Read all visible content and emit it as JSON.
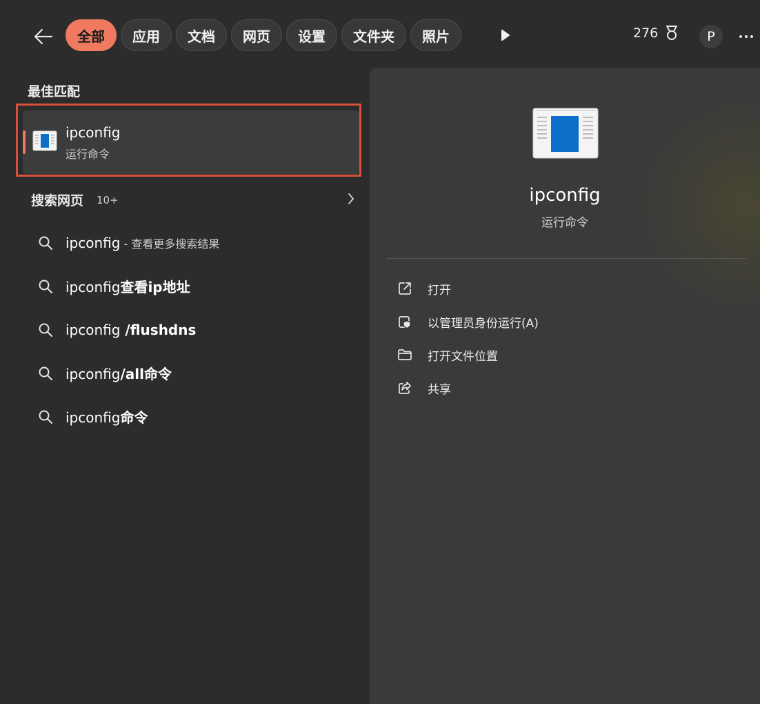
{
  "header": {
    "tabs": [
      {
        "label": "全部",
        "active": true
      },
      {
        "label": "应用",
        "active": false
      },
      {
        "label": "文档",
        "active": false
      },
      {
        "label": "网页",
        "active": false
      },
      {
        "label": "设置",
        "active": false
      },
      {
        "label": "文件夹",
        "active": false
      },
      {
        "label": "照片",
        "active": false
      }
    ],
    "points": "276",
    "avatar_initial": "P"
  },
  "best_match": {
    "title": "最佳匹配",
    "name": "ipconfig",
    "type": "运行命令"
  },
  "web_search": {
    "title": "搜索网页",
    "count": "10+",
    "suggestions": [
      {
        "prefix": "ipconfig",
        "rest": "",
        "sub": " - 查看更多搜索结果"
      },
      {
        "prefix": "ipconfig",
        "rest": "查看ip地址",
        "sub": ""
      },
      {
        "prefix": "ipconfig",
        "rest": " /flushdns",
        "sub": ""
      },
      {
        "prefix": "ipconfig",
        "rest": "/all命令",
        "sub": ""
      },
      {
        "prefix": "ipconfig",
        "rest": "命令",
        "sub": ""
      }
    ]
  },
  "detail": {
    "name": "ipconfig",
    "type": "运行命令",
    "actions": [
      {
        "label": "打开",
        "icon": "open-external-icon"
      },
      {
        "label": "以管理员身份运行(A)",
        "icon": "admin-shield-icon"
      },
      {
        "label": "打开文件位置",
        "icon": "folder-icon"
      },
      {
        "label": "共享",
        "icon": "share-icon"
      }
    ]
  },
  "colors": {
    "accent": "#f07a60",
    "highlight_border": "#d9503a",
    "background": "#2c2c2c",
    "panel": "#3a3a3a"
  }
}
